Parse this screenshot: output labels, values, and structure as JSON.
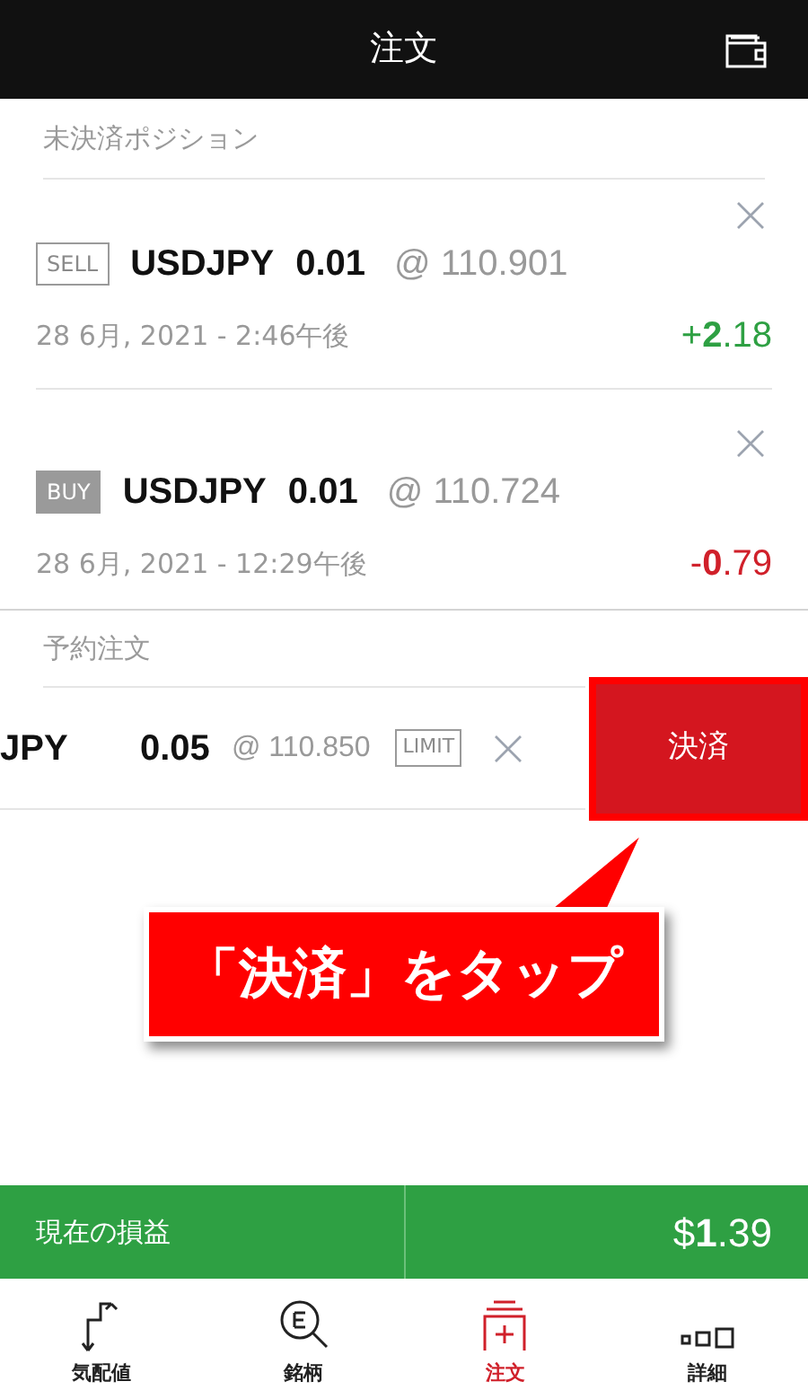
{
  "header": {
    "title": "注文"
  },
  "positions": {
    "label": "未決済ポジション",
    "items": [
      {
        "side": "SELL",
        "kind": "sell",
        "symbol": "USDJPY",
        "amount": "0.01",
        "price": "@ 110.901",
        "date": "28 6月, 2021 - 2:46午後",
        "pl": "+**2**.18",
        "color": "#2ea043"
      },
      {
        "side": "BUY",
        "kind": "buy",
        "symbol": "USDJPY",
        "amount": "0.01",
        "price": "@ 110.724",
        "date": "28 6月, 2021 - 12:29午後",
        "pl": "-**0**.79",
        "color": "#d0202a"
      }
    ]
  },
  "pending": {
    "label": "予約注文",
    "items": [
      {
        "symbol": "JPY",
        "amount": "0.05",
        "price": "@ 110.850",
        "type": "LIMIT",
        "action": "決済",
        "highlighted": true
      }
    ]
  },
  "callout": {
    "text": "「決済」をタップ"
  },
  "summary": {
    "label": "現在の損益",
    "value": "$**1**.39"
  },
  "tabs": [
    {
      "label": "気配値",
      "kind": "quotes",
      "selected": false
    },
    {
      "label": "銘柄",
      "kind": "symbols",
      "selected": false
    },
    {
      "label": "注文",
      "kind": "orders",
      "selected": true
    },
    {
      "label": "詳細",
      "kind": "details",
      "selected": false
    }
  ]
}
